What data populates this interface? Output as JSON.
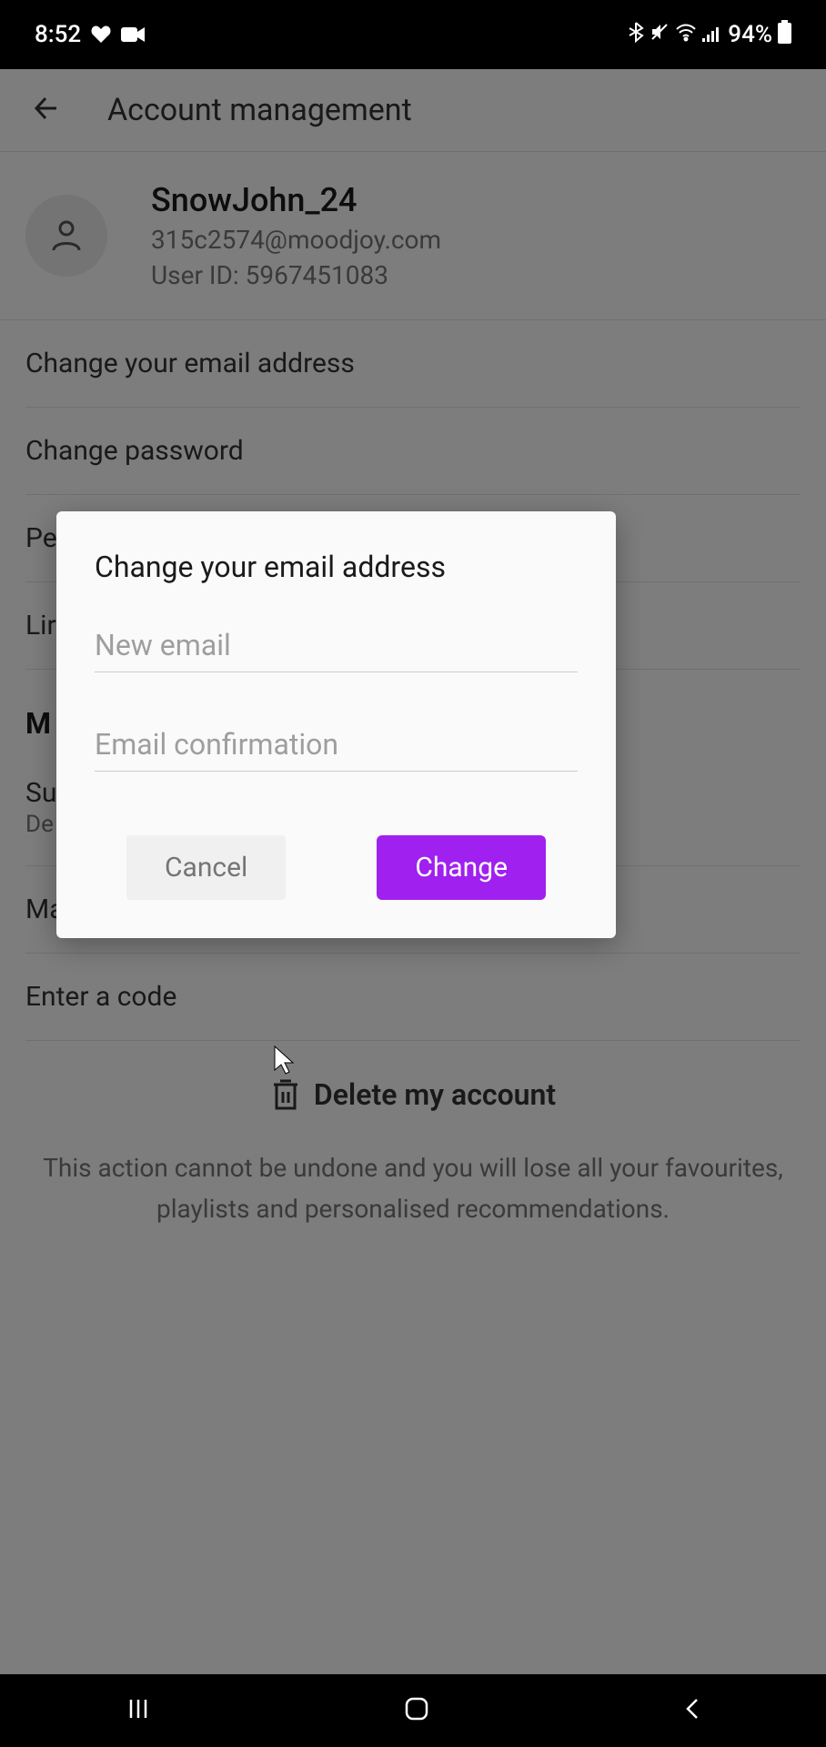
{
  "status": {
    "time": "8:52",
    "battery": "94%"
  },
  "header": {
    "title": "Account management"
  },
  "profile": {
    "username": "SnowJohn_24",
    "email": "315c2574@moodjoy.com",
    "userId": "User ID: 5967451083"
  },
  "settings": {
    "changeEmail": "Change your email address",
    "changePassword": "Change password",
    "personal": "Pe",
    "linked": "Lir",
    "sectionM": "M",
    "subscription": "Su",
    "deezerSub": "De",
    "manageSubscription": "Manage my subscription",
    "enterCode": "Enter a code"
  },
  "delete": {
    "label": "Delete my account",
    "warning": "This action cannot be undone and you will lose all your favourites, playlists and personalised recommendations."
  },
  "modal": {
    "title": "Change your email address",
    "newEmailPlaceholder": "New email",
    "confirmPlaceholder": "Email confirmation",
    "cancel": "Cancel",
    "change": "Change"
  }
}
